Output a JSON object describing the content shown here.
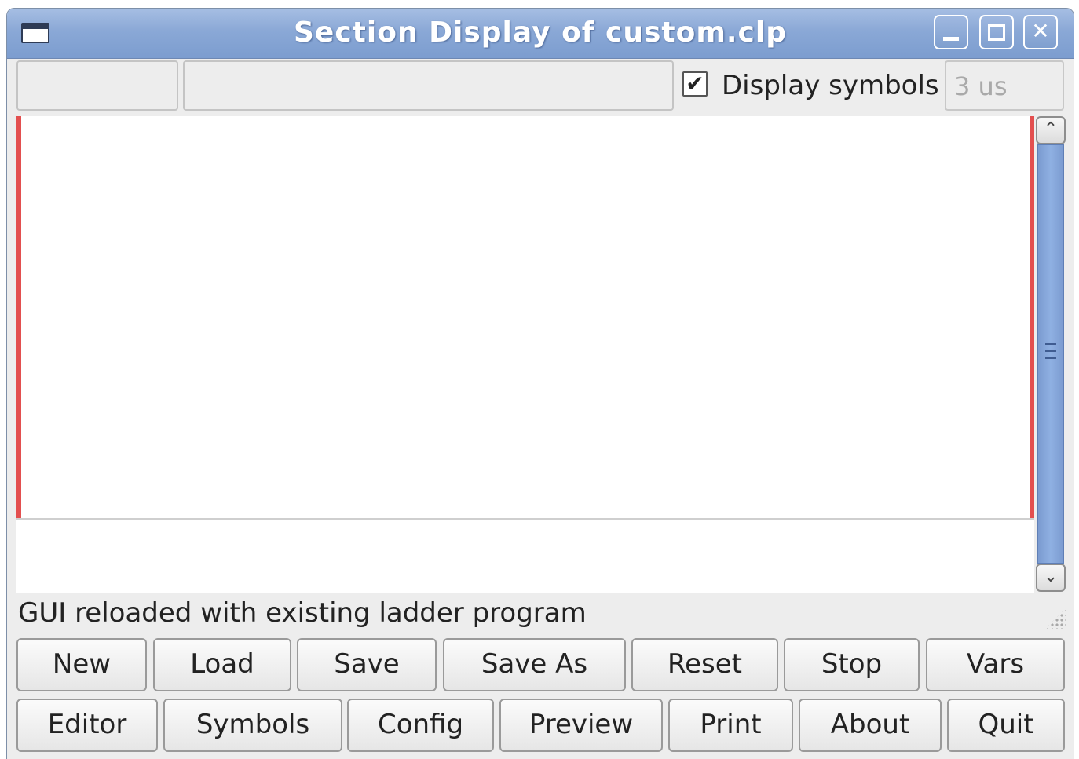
{
  "window": {
    "title": "Section Display of custom.clp"
  },
  "toolbar": {
    "display_symbols_label": "Display symbols",
    "display_symbols_checked": true,
    "check_glyph": "✔",
    "scan_time": "3 us"
  },
  "status": {
    "message": "GUI reloaded with existing ladder program"
  },
  "buttons_row1": [
    "New",
    "Load",
    "Save",
    "Save As",
    "Reset",
    "Stop",
    "Vars"
  ],
  "buttons_row2": [
    "Editor",
    "Symbols",
    "Config",
    "Preview",
    "Print",
    "About",
    "Quit"
  ],
  "icons": {
    "window_menu": "window-menu-icon",
    "minimize": "minimize-icon",
    "maximize": "maximize-icon",
    "close": "close-icon",
    "close_glyph": "✕",
    "scroll_up_glyph": "⌃",
    "scroll_down_glyph": "⌄"
  },
  "colors": {
    "titlebar": "#8aa8d6",
    "rail": "#e34f4f",
    "scrollbar_thumb": "#8fb0e2"
  }
}
